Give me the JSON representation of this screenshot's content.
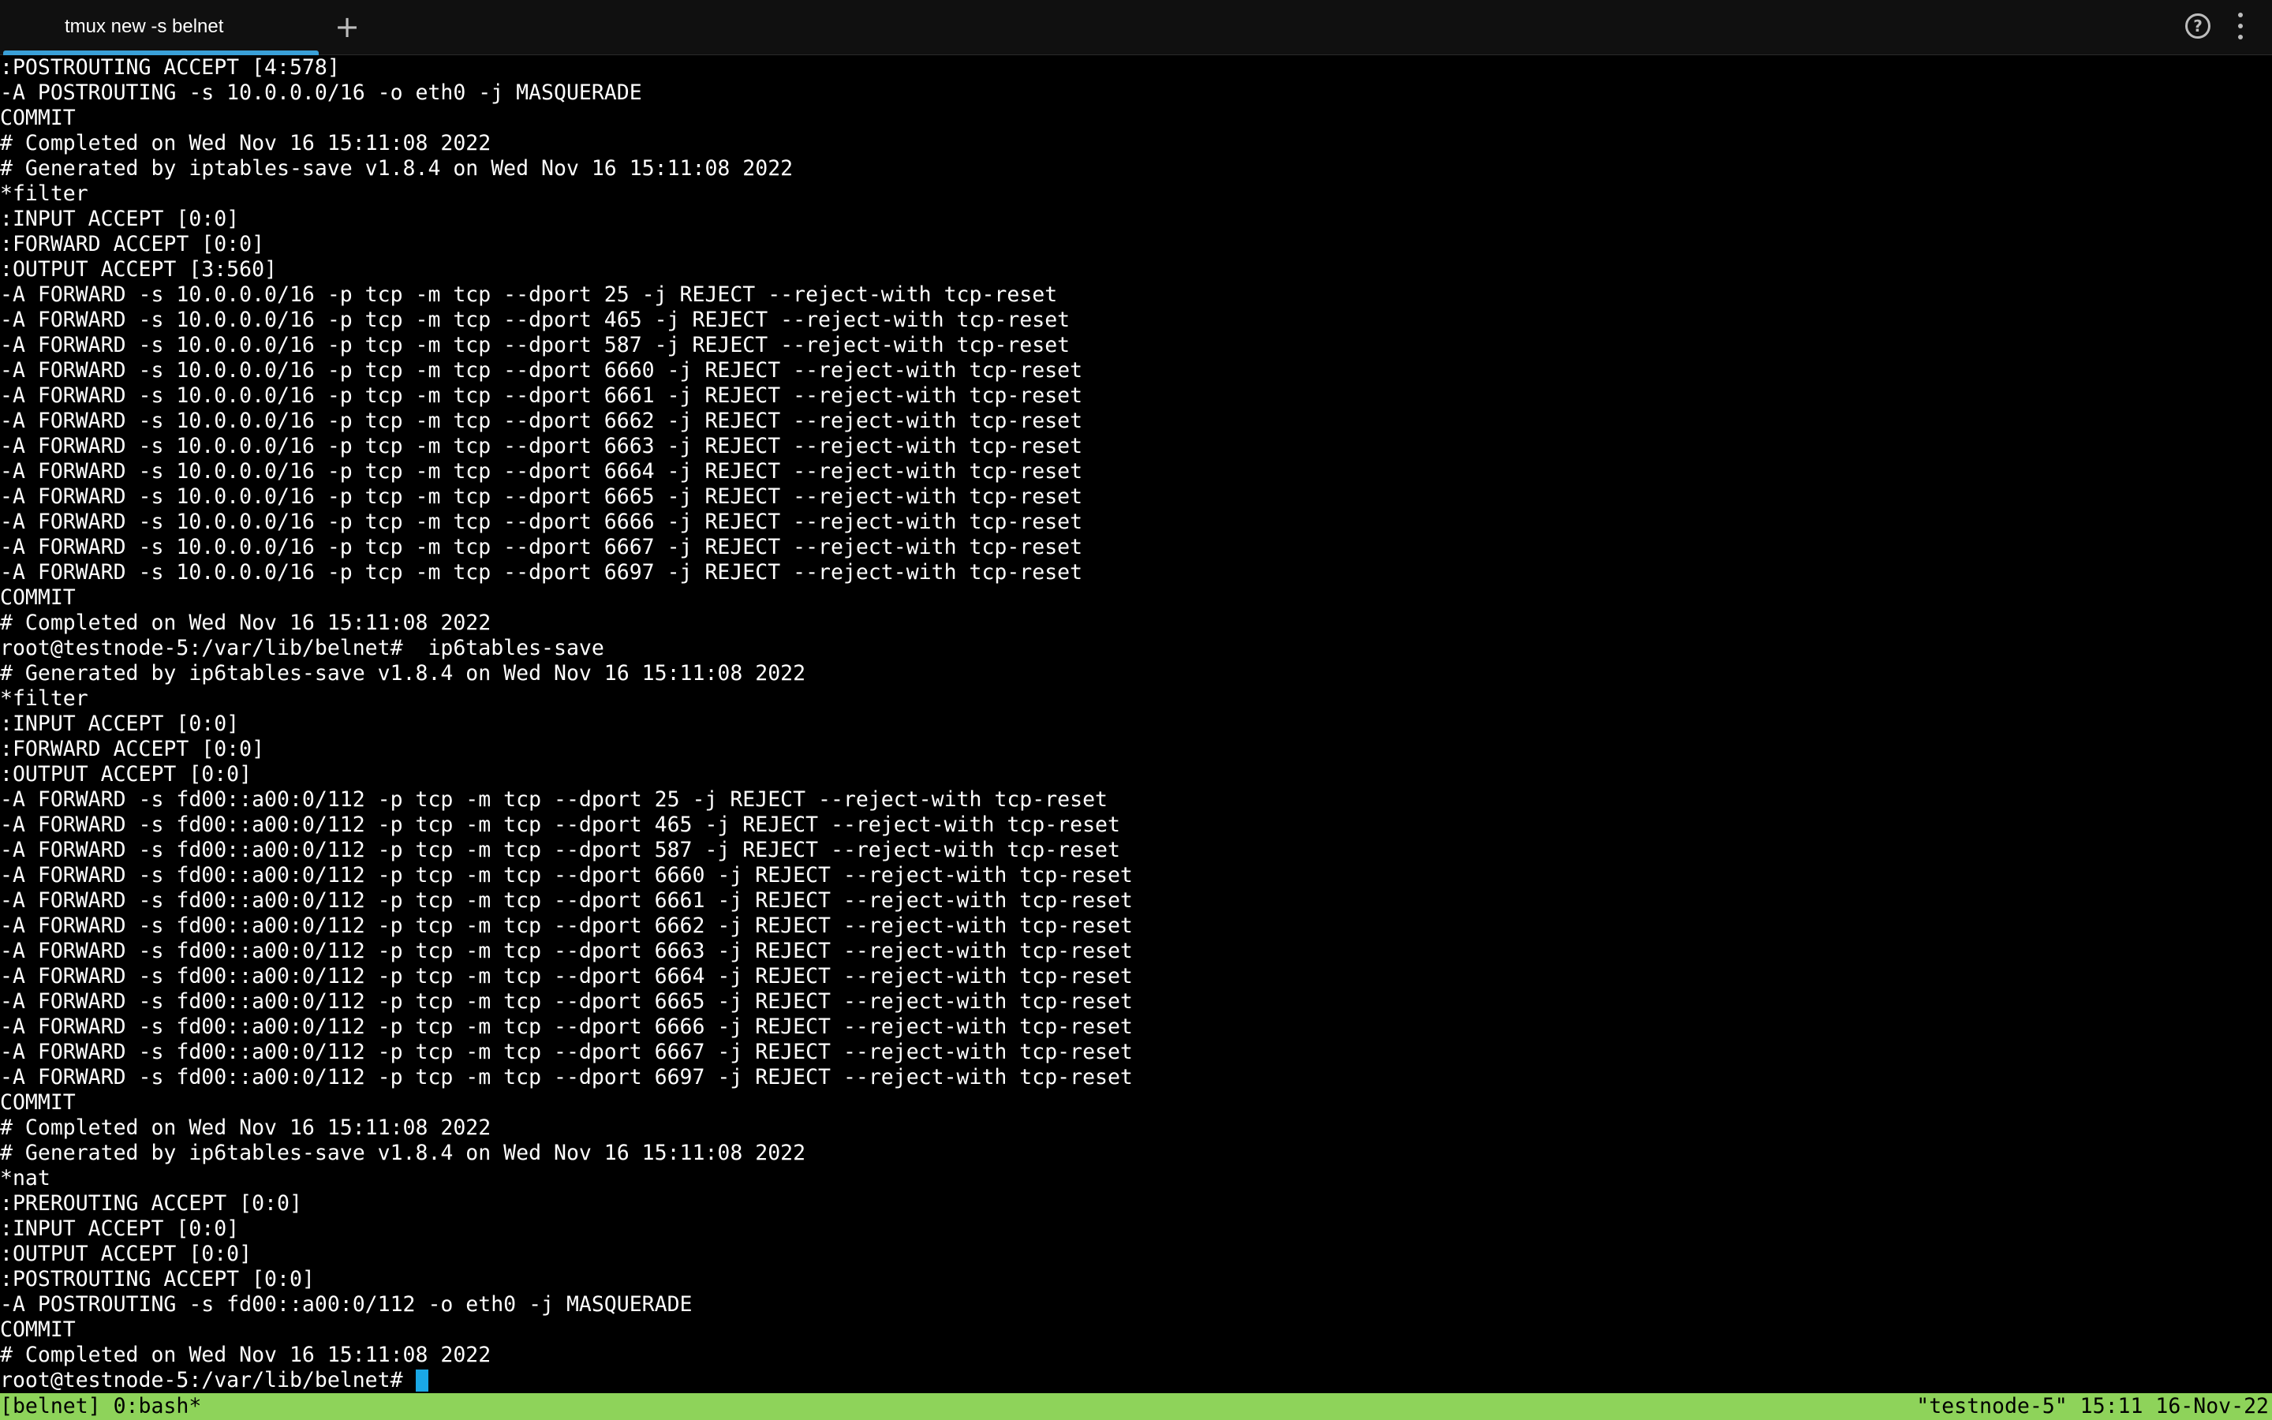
{
  "tab": {
    "title": "tmux new -s belnet",
    "new_tab_symbol": "+"
  },
  "header_icons": {
    "help_symbol": "?",
    "help_icon": "help-circle-icon",
    "menu_icon": "more-vertical-icon"
  },
  "terminal": {
    "lines": [
      ":POSTROUTING ACCEPT [4:578]",
      "-A POSTROUTING -s 10.0.0.0/16 -o eth0 -j MASQUERADE",
      "COMMIT",
      "# Completed on Wed Nov 16 15:11:08 2022",
      "# Generated by iptables-save v1.8.4 on Wed Nov 16 15:11:08 2022",
      "*filter",
      ":INPUT ACCEPT [0:0]",
      ":FORWARD ACCEPT [0:0]",
      ":OUTPUT ACCEPT [3:560]",
      "-A FORWARD -s 10.0.0.0/16 -p tcp -m tcp --dport 25 -j REJECT --reject-with tcp-reset",
      "-A FORWARD -s 10.0.0.0/16 -p tcp -m tcp --dport 465 -j REJECT --reject-with tcp-reset",
      "-A FORWARD -s 10.0.0.0/16 -p tcp -m tcp --dport 587 -j REJECT --reject-with tcp-reset",
      "-A FORWARD -s 10.0.0.0/16 -p tcp -m tcp --dport 6660 -j REJECT --reject-with tcp-reset",
      "-A FORWARD -s 10.0.0.0/16 -p tcp -m tcp --dport 6661 -j REJECT --reject-with tcp-reset",
      "-A FORWARD -s 10.0.0.0/16 -p tcp -m tcp --dport 6662 -j REJECT --reject-with tcp-reset",
      "-A FORWARD -s 10.0.0.0/16 -p tcp -m tcp --dport 6663 -j REJECT --reject-with tcp-reset",
      "-A FORWARD -s 10.0.0.0/16 -p tcp -m tcp --dport 6664 -j REJECT --reject-with tcp-reset",
      "-A FORWARD -s 10.0.0.0/16 -p tcp -m tcp --dport 6665 -j REJECT --reject-with tcp-reset",
      "-A FORWARD -s 10.0.0.0/16 -p tcp -m tcp --dport 6666 -j REJECT --reject-with tcp-reset",
      "-A FORWARD -s 10.0.0.0/16 -p tcp -m tcp --dport 6667 -j REJECT --reject-with tcp-reset",
      "-A FORWARD -s 10.0.0.0/16 -p tcp -m tcp --dport 6697 -j REJECT --reject-with tcp-reset",
      "COMMIT",
      "# Completed on Wed Nov 16 15:11:08 2022",
      "root@testnode-5:/var/lib/belnet#  ip6tables-save",
      "# Generated by ip6tables-save v1.8.4 on Wed Nov 16 15:11:08 2022",
      "*filter",
      ":INPUT ACCEPT [0:0]",
      ":FORWARD ACCEPT [0:0]",
      ":OUTPUT ACCEPT [0:0]",
      "-A FORWARD -s fd00::a00:0/112 -p tcp -m tcp --dport 25 -j REJECT --reject-with tcp-reset",
      "-A FORWARD -s fd00::a00:0/112 -p tcp -m tcp --dport 465 -j REJECT --reject-with tcp-reset",
      "-A FORWARD -s fd00::a00:0/112 -p tcp -m tcp --dport 587 -j REJECT --reject-with tcp-reset",
      "-A FORWARD -s fd00::a00:0/112 -p tcp -m tcp --dport 6660 -j REJECT --reject-with tcp-reset",
      "-A FORWARD -s fd00::a00:0/112 -p tcp -m tcp --dport 6661 -j REJECT --reject-with tcp-reset",
      "-A FORWARD -s fd00::a00:0/112 -p tcp -m tcp --dport 6662 -j REJECT --reject-with tcp-reset",
      "-A FORWARD -s fd00::a00:0/112 -p tcp -m tcp --dport 6663 -j REJECT --reject-with tcp-reset",
      "-A FORWARD -s fd00::a00:0/112 -p tcp -m tcp --dport 6664 -j REJECT --reject-with tcp-reset",
      "-A FORWARD -s fd00::a00:0/112 -p tcp -m tcp --dport 6665 -j REJECT --reject-with tcp-reset",
      "-A FORWARD -s fd00::a00:0/112 -p tcp -m tcp --dport 6666 -j REJECT --reject-with tcp-reset",
      "-A FORWARD -s fd00::a00:0/112 -p tcp -m tcp --dport 6667 -j REJECT --reject-with tcp-reset",
      "-A FORWARD -s fd00::a00:0/112 -p tcp -m tcp --dport 6697 -j REJECT --reject-with tcp-reset",
      "COMMIT",
      "# Completed on Wed Nov 16 15:11:08 2022",
      "# Generated by ip6tables-save v1.8.4 on Wed Nov 16 15:11:08 2022",
      "*nat",
      ":PREROUTING ACCEPT [0:0]",
      ":INPUT ACCEPT [0:0]",
      ":OUTPUT ACCEPT [0:0]",
      ":POSTROUTING ACCEPT [0:0]",
      "-A POSTROUTING -s fd00::a00:0/112 -o eth0 -j MASQUERADE",
      "COMMIT",
      "# Completed on Wed Nov 16 15:11:08 2022"
    ],
    "prompt": "root@testnode-5:/var/lib/belnet#"
  },
  "statusbar": {
    "left": "[belnet] 0:bash*",
    "right": "\"testnode-5\" 15:11 16-Nov-22"
  },
  "colors": {
    "tab_accent": "#3aa0d8",
    "cursor": "#1aa8e6",
    "statusbar_bg": "#8ed35a"
  }
}
